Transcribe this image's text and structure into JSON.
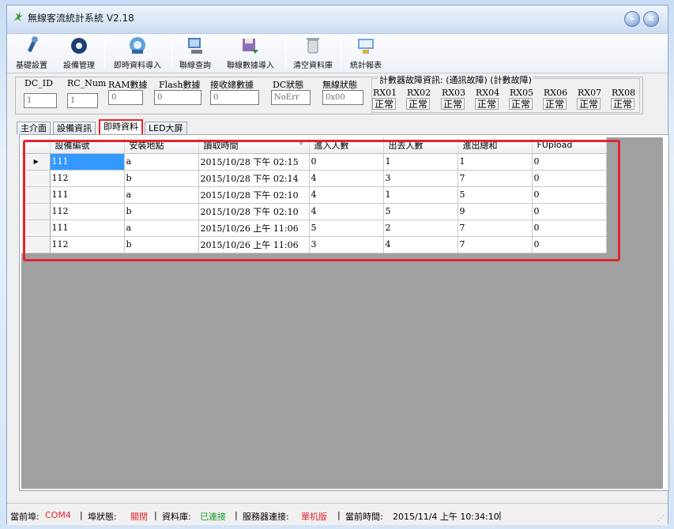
{
  "window": {
    "title": "無線客流統計系統  V2.18",
    "minimize_glyph": "–",
    "close_glyph": "×"
  },
  "toolbar": [
    {
      "label": "基礎設置",
      "icon": "wrench-icon"
    },
    {
      "label": "設備管理",
      "icon": "gear-icon"
    },
    {
      "label": "即時資料導入",
      "icon": "network-icon"
    },
    {
      "label": "聯線查詢",
      "icon": "monitor-icon"
    },
    {
      "label": "聯線數據導入",
      "icon": "disk-icon"
    },
    {
      "label": "清空資料庫",
      "icon": "trash-icon"
    },
    {
      "label": "統計報表",
      "icon": "chart-icon"
    }
  ],
  "status_panel": {
    "fields": [
      {
        "label": "DC_ID",
        "value": "1"
      },
      {
        "label": "RC_Num",
        "value": "1"
      },
      {
        "label": "RAM數據",
        "value": "0"
      },
      {
        "label": "Flash數據",
        "value": "0"
      },
      {
        "label": "接收總數據",
        "value": "0"
      },
      {
        "label": "DC狀態",
        "value": "NoErr"
      },
      {
        "label": "無線狀態",
        "value": "0x00"
      }
    ],
    "fault_group_title": "計數器故障資訊: (通訊故障) (計數故障)",
    "receivers": [
      {
        "name": "RX01",
        "status": "正常"
      },
      {
        "name": "RX02",
        "status": "正常"
      },
      {
        "name": "RX03",
        "status": "正常"
      },
      {
        "name": "RX04",
        "status": "正常"
      },
      {
        "name": "RX05",
        "status": "正常"
      },
      {
        "name": "RX06",
        "status": "正常"
      },
      {
        "name": "RX07",
        "status": "正常"
      },
      {
        "name": "RX08",
        "status": "正常"
      }
    ]
  },
  "tabs": [
    {
      "label": "主介面",
      "active": false
    },
    {
      "label": "設備資訊",
      "active": false
    },
    {
      "label": "即時資料",
      "active": true
    },
    {
      "label": "LED大屏",
      "active": false
    }
  ],
  "grid": {
    "columns": [
      "設備編號",
      "安裝地點",
      "讀取時間",
      "進入人數",
      "出去人數",
      "進出總和",
      "FUpload"
    ],
    "sorted_column_glyph": "▼",
    "current_row_glyph": "▶",
    "rows": [
      [
        "111",
        "a",
        "2015/10/28 下午 02:15",
        "0",
        "1",
        "1",
        "0"
      ],
      [
        "112",
        "b",
        "2015/10/28 下午 02:14",
        "4",
        "3",
        "7",
        "0"
      ],
      [
        "111",
        "a",
        "2015/10/28 下午 02:10",
        "4",
        "1",
        "5",
        "0"
      ],
      [
        "112",
        "b",
        "2015/10/28 下午 02:10",
        "4",
        "5",
        "9",
        "0"
      ],
      [
        "111",
        "a",
        "2015/10/26 上午 11:06",
        "5",
        "2",
        "7",
        "0"
      ],
      [
        "112",
        "b",
        "2015/10/26 上午 11:06",
        "3",
        "4",
        "7",
        "0"
      ]
    ]
  },
  "statusbar": {
    "port_label": "當前埠:",
    "port_value": "COM4",
    "port_state_label": "埠狀態:",
    "port_state_value": "關閉",
    "db_label": "資料庫:",
    "db_value": "已連接",
    "server_label": "服務器連接:",
    "server_value": "單机版",
    "time_label": "當前時間:",
    "time_value": "2015/11/4 上午 10:34:10",
    "separator": "|"
  },
  "colors": {
    "highlight": "#e0252f",
    "selection": "#3399ff",
    "ok": "#1a9b2a"
  }
}
